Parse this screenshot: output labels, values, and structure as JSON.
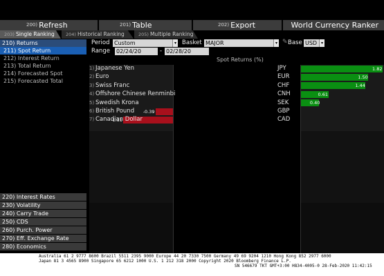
{
  "toolbar": {
    "buttons": [
      {
        "num": "200)",
        "label": "Refresh"
      },
      {
        "num": "201)",
        "label": "Table"
      },
      {
        "num": "202)",
        "label": "Export"
      }
    ],
    "title": "World Currency Ranker"
  },
  "tabs": [
    {
      "num": "203)",
      "label": "Single Ranking"
    },
    {
      "num": "204)",
      "label": "Historical Ranking"
    },
    {
      "num": "205)",
      "label": "Multiple Ranking"
    }
  ],
  "menu": {
    "header": "210) Returns",
    "items": [
      "211) Spot Return",
      "212) Interest Return",
      "213) Total Return",
      "214) Forecasted Spot",
      "215) Forecasted Total"
    ],
    "bottom": [
      "220) Interest Rates",
      "230) Volatility",
      "240) Carry Trade",
      "250) CDS",
      "260) Purch. Power",
      "270) Eff. Exchange Rate",
      "280) Economics"
    ]
  },
  "controls": {
    "period_label": "Period",
    "period_value": "Custom",
    "basket_label": "Basket",
    "basket_value": "MAJOR",
    "base_label": "Base",
    "base_value": "USD",
    "range_label": "Range",
    "date_from": "02/24/20",
    "date_sep": "-",
    "date_to": "02/28/20"
  },
  "table": {
    "column_header": "Spot Returns (%)",
    "rows": [
      {
        "idx": "1)",
        "currency": "Japanese Yen",
        "code": "JPY",
        "value": 1.82
      },
      {
        "idx": "2)",
        "currency": "Euro",
        "code": "EUR",
        "value": 1.5
      },
      {
        "idx": "3)",
        "currency": "Swiss Franc",
        "code": "CHF",
        "value": 1.44
      },
      {
        "idx": "4)",
        "currency": "Offshore Chinese Renminbi",
        "code": "CNH",
        "value": 0.61
      },
      {
        "idx": "5)",
        "currency": "Swedish Krona",
        "code": "SEK",
        "value": 0.4
      },
      {
        "idx": "6)",
        "currency": "British Pound",
        "code": "GBP",
        "value": -0.39
      },
      {
        "idx": "7)",
        "currency": "Canadian Dollar",
        "code": "CAD",
        "value": -1.11
      }
    ],
    "value_labels": [
      "1.82",
      "1.50",
      "1.44",
      "0.61",
      "0.40",
      "-0.39",
      "-1.11"
    ]
  },
  "colors": {
    "positive": "#0a8f12",
    "negative": "#a8101c",
    "menu_selected": "#1a5fb4"
  },
  "footer": {
    "line1": "Australia 61 2 9777 8600 Brazil 5511 2395 9000 Europe 44 20 7330 7500 Germany 49 69 9204 1210 Hong Kong 852 2977 6000",
    "line2": "Japan 81 3 4565 8900        Singapore 65 6212 1000        U.S. 1 212 318 2000          Copyright 2020 Bloomberg Finance L.P.",
    "line3": "SN 546679 TKT  GMT+3:00 H834-4005-0 28-Feb-2020 11:42:15"
  }
}
